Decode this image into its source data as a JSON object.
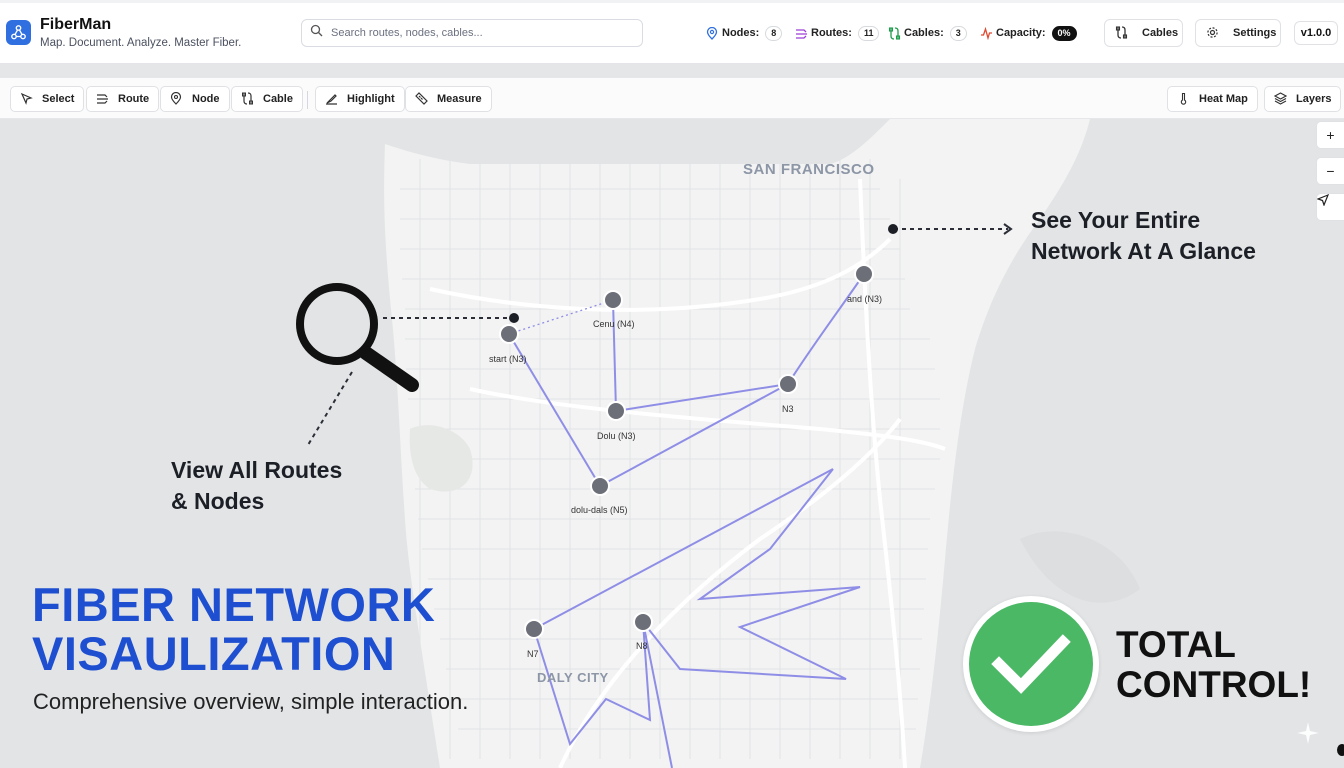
{
  "app": {
    "name": "FiberMan",
    "tagline": "Map. Document. Analyze. Master Fiber.",
    "version": "v1.0.0",
    "accent": "#2f6fe0"
  },
  "search": {
    "placeholder": "Search routes, nodes, cables..."
  },
  "stats": [
    {
      "name": "nodes",
      "label": "Nodes:",
      "value": "8",
      "icon": "map-pin-icon",
      "color": "#2f6fe0"
    },
    {
      "name": "routes",
      "label": "Routes:",
      "value": "11",
      "icon": "route-icon",
      "color": "#9c3fd6"
    },
    {
      "name": "cables",
      "label": "Cables:",
      "value": "3",
      "icon": "cable-icon",
      "color": "#1d9a4a"
    },
    {
      "name": "capacity",
      "label": "Capacity:",
      "value": "0%",
      "icon": "pulse-icon",
      "color": "#e0482f"
    }
  ],
  "header_buttons": {
    "cables": "Cables",
    "settings": "Settings"
  },
  "tools": [
    {
      "label": "Select",
      "icon": "cursor-icon"
    },
    {
      "label": "Route",
      "icon": "route-icon"
    },
    {
      "label": "Node",
      "icon": "map-pin-icon"
    },
    {
      "label": "Cable",
      "icon": "cable-icon"
    },
    {
      "label": "Highlight",
      "icon": "highlighter-icon"
    },
    {
      "label": "Measure",
      "icon": "ruler-icon"
    }
  ],
  "view_tools": [
    {
      "label": "Heat Map",
      "icon": "thermometer-icon"
    },
    {
      "label": "Layers",
      "icon": "layers-icon"
    }
  ],
  "map_controls": {
    "zoom_in": "+",
    "zoom_out": "−"
  },
  "map_labels": {
    "city_north": "SAN FRANCISCO",
    "city_south": "DALY CITY"
  },
  "nodes": [
    {
      "id": "start",
      "label": "start (N3)"
    },
    {
      "id": "cenu",
      "label": "Cenu (N4)"
    },
    {
      "id": "dolu",
      "label": "Dolu (N3)"
    },
    {
      "id": "doludals",
      "label": "dolu-dals (N5)"
    },
    {
      "id": "n3",
      "label": "N3"
    },
    {
      "id": "end",
      "label": "and (N3)"
    },
    {
      "id": "n7",
      "label": "N7"
    },
    {
      "id": "n8",
      "label": "N8"
    }
  ],
  "route_color": "#8f8ee6",
  "node_color": "#6c6f78",
  "marketing": {
    "callout_top": [
      "See Your Entire",
      "Network At A Glance"
    ],
    "callout_left": [
      "View All Routes",
      "& Nodes"
    ],
    "headline": [
      "FIBER NETWORK",
      "VISAULIZATION"
    ],
    "subline": "Comprehensive overview, simple interaction.",
    "total": [
      "TOTAL",
      "CONTROL!"
    ],
    "headline_color": "#1f4fd1",
    "check_color": "#4bb866"
  }
}
